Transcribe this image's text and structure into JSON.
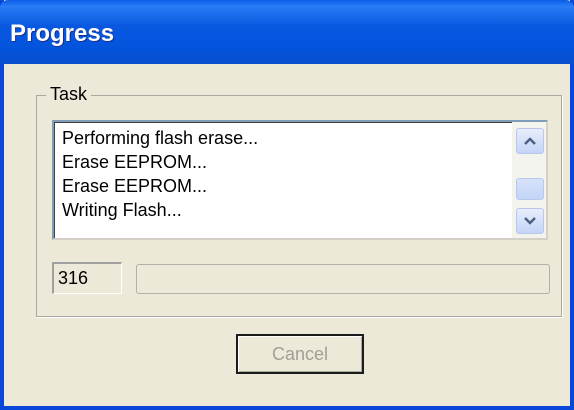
{
  "window": {
    "title": "Progress"
  },
  "task_group": {
    "label": "Task",
    "log_items": [
      "Performing flash erase...",
      "Erase EEPROM...",
      "Erase EEPROM...",
      "Writing Flash..."
    ]
  },
  "counter": {
    "value": "316"
  },
  "progress": {
    "fraction": 0.0
  },
  "buttons": {
    "cancel_label": "Cancel"
  },
  "icons": {
    "scroll_up": "chevron-up-icon",
    "scroll_down": "chevron-down-icon"
  },
  "colors": {
    "titlebar": "#0a58e0",
    "window_bg": "#ece9d8",
    "disabled_text": "#a09f95"
  }
}
